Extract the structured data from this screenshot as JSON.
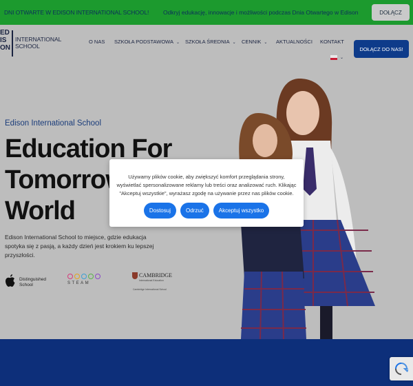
{
  "topbar": {
    "announcement": "DNI OTWARTE W EDISON INTERNATIONAL SCHOOL!",
    "promo": "Odkryj edukację, innowacje i możliwości podczas Dnia Otwartego w Edison",
    "join_label": "DOŁĄCZ"
  },
  "logo": {
    "mark_lines": [
      "ED",
      "IS",
      "ON"
    ],
    "name_line1": "INTERNATIONAL",
    "name_line2": "SCHOOL"
  },
  "nav": {
    "items": [
      {
        "label": "O NAS",
        "has_dropdown": false
      },
      {
        "label": "SZKOŁA PODSTAWOWA",
        "has_dropdown": true
      },
      {
        "label": "SZKOŁA ŚREDNIA",
        "has_dropdown": true
      },
      {
        "label": "CENNIK",
        "has_dropdown": true
      },
      {
        "label": "AKTUALNOŚCI",
        "has_dropdown": false
      },
      {
        "label": "KONTAKT",
        "has_dropdown": false
      }
    ],
    "cta_label": "DOŁĄCZ DO NAS!",
    "chevron": "⌄"
  },
  "hero": {
    "subtitle": "Edison International School",
    "headline_line1": "Education For",
    "headline_line2": "Tomorrow's",
    "headline_line3": "World",
    "description": "Edison International School to miejsce, gdzie edukacja spotyka się z pasją, a każdy dzień jest krokiem ku lepszej przyszłości."
  },
  "partners": {
    "apple_line1": "Distinguished",
    "apple_line2": "School",
    "steam_label": "STEAM",
    "cambridge_name": "CAMBRIDGE",
    "cambridge_sub": "International Education",
    "cambridge_note": "Cambridge International School"
  },
  "cookie": {
    "message": "Używamy plików cookie, aby zwiększyć komfort przeglądania strony, wyświetlać spersonalizowane reklamy lub treści oraz analizować ruch. Klikając \"Akceptuj wszystkie\", wyrażasz zgodę na używanie przez nas plików cookie.",
    "customize_label": "Dostosuj",
    "reject_label": "Odrzuć",
    "accept_label": "Akceptuj wszystko"
  },
  "colors": {
    "topbar": "#1c9a2e",
    "primary_blue": "#0e3b8a",
    "cookie_button": "#1a73e8",
    "band": "#0d2f7a"
  },
  "icons": {
    "apple": "apple-icon",
    "recaptcha": "recaptcha-icon",
    "flag": "polish-flag-icon"
  }
}
